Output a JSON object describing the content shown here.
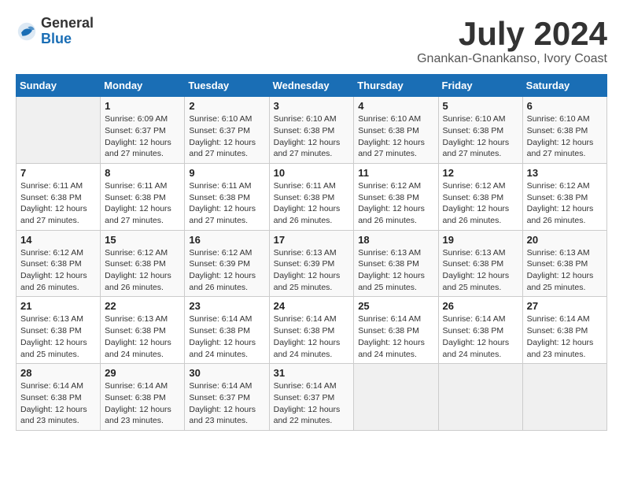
{
  "logo": {
    "text_general": "General",
    "text_blue": "Blue"
  },
  "title": "July 2024",
  "subtitle": "Gnankan-Gnankanso, Ivory Coast",
  "days_header": [
    "Sunday",
    "Monday",
    "Tuesday",
    "Wednesday",
    "Thursday",
    "Friday",
    "Saturday"
  ],
  "weeks": [
    [
      {
        "day": "",
        "info": ""
      },
      {
        "day": "1",
        "info": "Sunrise: 6:09 AM\nSunset: 6:37 PM\nDaylight: 12 hours\nand 27 minutes."
      },
      {
        "day": "2",
        "info": "Sunrise: 6:10 AM\nSunset: 6:37 PM\nDaylight: 12 hours\nand 27 minutes."
      },
      {
        "day": "3",
        "info": "Sunrise: 6:10 AM\nSunset: 6:38 PM\nDaylight: 12 hours\nand 27 minutes."
      },
      {
        "day": "4",
        "info": "Sunrise: 6:10 AM\nSunset: 6:38 PM\nDaylight: 12 hours\nand 27 minutes."
      },
      {
        "day": "5",
        "info": "Sunrise: 6:10 AM\nSunset: 6:38 PM\nDaylight: 12 hours\nand 27 minutes."
      },
      {
        "day": "6",
        "info": "Sunrise: 6:10 AM\nSunset: 6:38 PM\nDaylight: 12 hours\nand 27 minutes."
      }
    ],
    [
      {
        "day": "7",
        "info": "Sunrise: 6:11 AM\nSunset: 6:38 PM\nDaylight: 12 hours\nand 27 minutes."
      },
      {
        "day": "8",
        "info": "Sunrise: 6:11 AM\nSunset: 6:38 PM\nDaylight: 12 hours\nand 27 minutes."
      },
      {
        "day": "9",
        "info": "Sunrise: 6:11 AM\nSunset: 6:38 PM\nDaylight: 12 hours\nand 27 minutes."
      },
      {
        "day": "10",
        "info": "Sunrise: 6:11 AM\nSunset: 6:38 PM\nDaylight: 12 hours\nand 26 minutes."
      },
      {
        "day": "11",
        "info": "Sunrise: 6:12 AM\nSunset: 6:38 PM\nDaylight: 12 hours\nand 26 minutes."
      },
      {
        "day": "12",
        "info": "Sunrise: 6:12 AM\nSunset: 6:38 PM\nDaylight: 12 hours\nand 26 minutes."
      },
      {
        "day": "13",
        "info": "Sunrise: 6:12 AM\nSunset: 6:38 PM\nDaylight: 12 hours\nand 26 minutes."
      }
    ],
    [
      {
        "day": "14",
        "info": "Sunrise: 6:12 AM\nSunset: 6:38 PM\nDaylight: 12 hours\nand 26 minutes."
      },
      {
        "day": "15",
        "info": "Sunrise: 6:12 AM\nSunset: 6:38 PM\nDaylight: 12 hours\nand 26 minutes."
      },
      {
        "day": "16",
        "info": "Sunrise: 6:12 AM\nSunset: 6:39 PM\nDaylight: 12 hours\nand 26 minutes."
      },
      {
        "day": "17",
        "info": "Sunrise: 6:13 AM\nSunset: 6:39 PM\nDaylight: 12 hours\nand 25 minutes."
      },
      {
        "day": "18",
        "info": "Sunrise: 6:13 AM\nSunset: 6:38 PM\nDaylight: 12 hours\nand 25 minutes."
      },
      {
        "day": "19",
        "info": "Sunrise: 6:13 AM\nSunset: 6:38 PM\nDaylight: 12 hours\nand 25 minutes."
      },
      {
        "day": "20",
        "info": "Sunrise: 6:13 AM\nSunset: 6:38 PM\nDaylight: 12 hours\nand 25 minutes."
      }
    ],
    [
      {
        "day": "21",
        "info": "Sunrise: 6:13 AM\nSunset: 6:38 PM\nDaylight: 12 hours\nand 25 minutes."
      },
      {
        "day": "22",
        "info": "Sunrise: 6:13 AM\nSunset: 6:38 PM\nDaylight: 12 hours\nand 24 minutes."
      },
      {
        "day": "23",
        "info": "Sunrise: 6:14 AM\nSunset: 6:38 PM\nDaylight: 12 hours\nand 24 minutes."
      },
      {
        "day": "24",
        "info": "Sunrise: 6:14 AM\nSunset: 6:38 PM\nDaylight: 12 hours\nand 24 minutes."
      },
      {
        "day": "25",
        "info": "Sunrise: 6:14 AM\nSunset: 6:38 PM\nDaylight: 12 hours\nand 24 minutes."
      },
      {
        "day": "26",
        "info": "Sunrise: 6:14 AM\nSunset: 6:38 PM\nDaylight: 12 hours\nand 24 minutes."
      },
      {
        "day": "27",
        "info": "Sunrise: 6:14 AM\nSunset: 6:38 PM\nDaylight: 12 hours\nand 23 minutes."
      }
    ],
    [
      {
        "day": "28",
        "info": "Sunrise: 6:14 AM\nSunset: 6:38 PM\nDaylight: 12 hours\nand 23 minutes."
      },
      {
        "day": "29",
        "info": "Sunrise: 6:14 AM\nSunset: 6:38 PM\nDaylight: 12 hours\nand 23 minutes."
      },
      {
        "day": "30",
        "info": "Sunrise: 6:14 AM\nSunset: 6:37 PM\nDaylight: 12 hours\nand 23 minutes."
      },
      {
        "day": "31",
        "info": "Sunrise: 6:14 AM\nSunset: 6:37 PM\nDaylight: 12 hours\nand 22 minutes."
      },
      {
        "day": "",
        "info": ""
      },
      {
        "day": "",
        "info": ""
      },
      {
        "day": "",
        "info": ""
      }
    ]
  ]
}
